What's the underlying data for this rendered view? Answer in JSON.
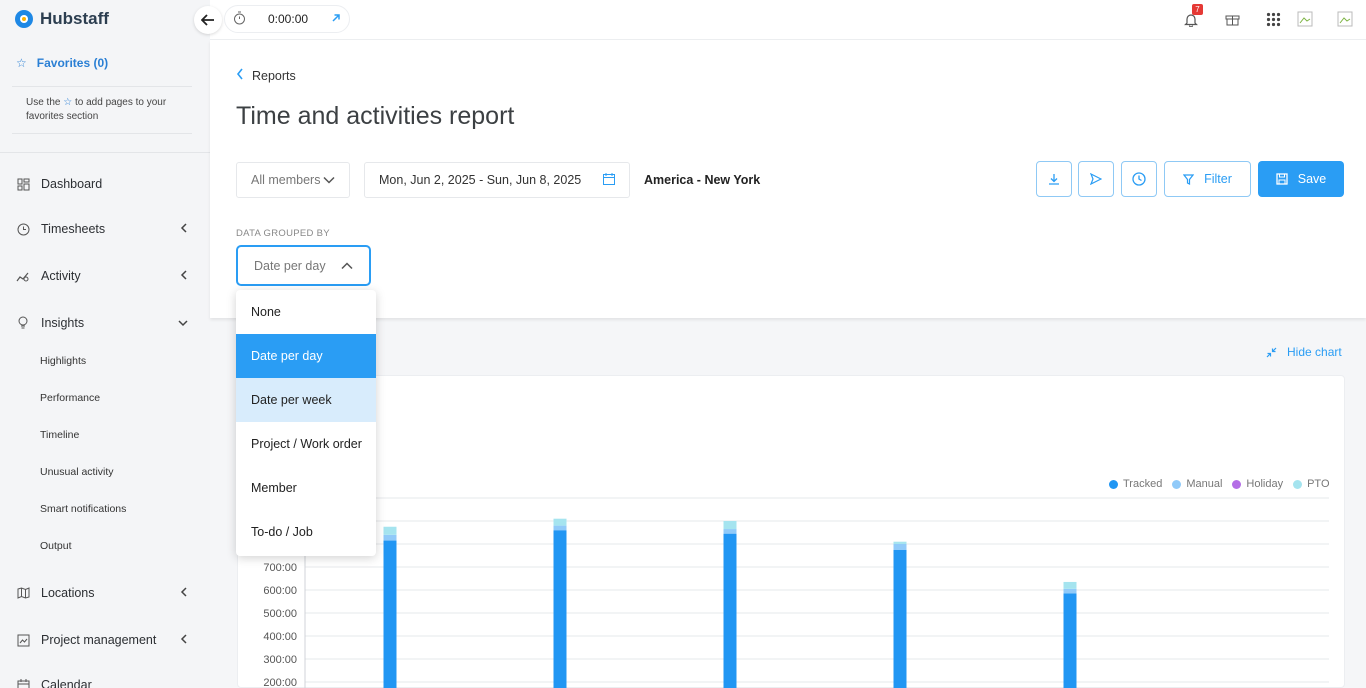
{
  "brand": {
    "name": "Hubstaff"
  },
  "favorites": {
    "label": "Favorites (0)",
    "hint_prefix": "Use the",
    "hint_suffix": "to add pages to your favorites section"
  },
  "sidebar": {
    "items": [
      {
        "label": "Dashboard",
        "icon": "dashboard-icon"
      },
      {
        "label": "Timesheets",
        "icon": "clock-icon"
      },
      {
        "label": "Activity",
        "icon": "activity-icon"
      },
      {
        "label": "Insights",
        "icon": "bulb-icon"
      },
      {
        "label": "Locations",
        "icon": "map-icon"
      },
      {
        "label": "Project management",
        "icon": "project-icon"
      },
      {
        "label": "Calendar",
        "icon": "calendar-icon"
      }
    ],
    "insights_sub": [
      "Highlights",
      "Performance",
      "Timeline",
      "Unusual activity",
      "Smart notifications",
      "Output"
    ]
  },
  "topbar": {
    "timer": "0:00:00",
    "notifications_count": "7"
  },
  "breadcrumb": {
    "label": "Reports"
  },
  "page": {
    "title": "Time and activities report"
  },
  "filters": {
    "members": "All members",
    "date_range": "Mon, Jun 2, 2025 - Sun, Jun 8, 2025",
    "timezone": "America - New York",
    "filter_label": "Filter",
    "save_label": "Save"
  },
  "grouping": {
    "label": "DATA GROUPED BY",
    "selected": "Date per day",
    "options": [
      "None",
      "Date per day",
      "Date per week",
      "Project / Work order",
      "Member",
      "To-do / Job"
    ]
  },
  "chart": {
    "hide_label": "Hide chart"
  },
  "chart_data": {
    "type": "bar",
    "legend": [
      "Tracked",
      "Manual",
      "Holiday",
      "PTO"
    ],
    "colors": {
      "Tracked": "#2196f3",
      "Manual": "#90caf9",
      "Holiday": "#b46ee6",
      "PTO": "#a5e4ef"
    },
    "y_ticks": [
      "700:00",
      "600:00",
      "500:00",
      "400:00",
      "300:00",
      "200:00"
    ],
    "ylim": [
      200,
      700
    ],
    "series": [
      {
        "name": "Tracked",
        "values": [
          815,
          860,
          845,
          775,
          585
        ]
      },
      {
        "name": "Manual",
        "values": [
          25,
          20,
          20,
          25,
          20
        ]
      },
      {
        "name": "PTO",
        "values": [
          35,
          30,
          35,
          10,
          30
        ]
      }
    ]
  }
}
